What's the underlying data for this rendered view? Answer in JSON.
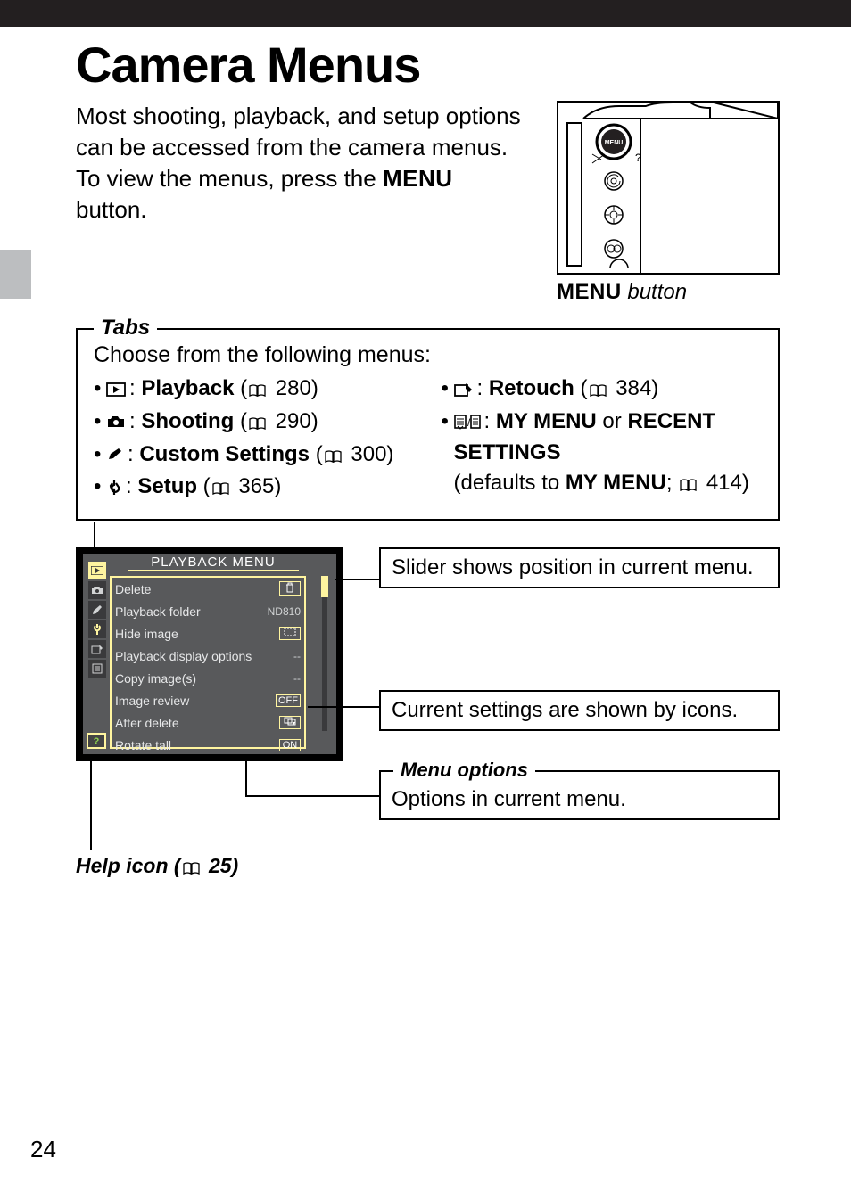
{
  "page_number": "24",
  "title": "Camera Menus",
  "intro": "Most shooting, playback, and setup options can be accessed from the camera menus.  To view the menus, press the ",
  "intro_menu_word": "MENU",
  "intro_tail": " button.",
  "camera_caption_menu": "MENU",
  "camera_caption_button": " button",
  "tabs": {
    "heading": "Tabs",
    "lead": "Choose from the following menus:",
    "left": [
      {
        "icon": "playback",
        "label": "Playback",
        "page": "280"
      },
      {
        "icon": "shooting",
        "label": "Shooting",
        "page": "290"
      },
      {
        "icon": "custom",
        "label": "Custom Settings",
        "page": "300"
      },
      {
        "icon": "setup",
        "label": "Setup",
        "page": "365"
      }
    ],
    "right": [
      {
        "icon": "retouch",
        "label": "Retouch",
        "page": "384"
      },
      {
        "icon": "mymenu",
        "label": "MY MENU",
        "or": " or ",
        "label2": "RECENT SETTINGS"
      }
    ],
    "defaults_pre": "(defaults to ",
    "defaults_bold": "MY MENU",
    "defaults_sep": "; ",
    "defaults_page": "414",
    "defaults_post": ")"
  },
  "screen": {
    "title": "PLAYBACK MENU",
    "options": [
      {
        "label": "Delete",
        "val_icon": "trash"
      },
      {
        "label": "Playback folder",
        "val_text": "ND810"
      },
      {
        "label": "Hide image",
        "val_icon": "hide"
      },
      {
        "label": "Playback display options",
        "val_text": "--"
      },
      {
        "label": "Copy image(s)",
        "val_text": "--"
      },
      {
        "label": "Image review",
        "val_text": "OFF"
      },
      {
        "label": "After delete",
        "val_icon": "after"
      },
      {
        "label": "Rotate tall",
        "val_text": "ON"
      }
    ]
  },
  "callouts": {
    "slider": "Slider shows position in current menu.",
    "icons": "Current settings are shown by icons.",
    "menu_options_title": "Menu options",
    "menu_options_text": "Options in current menu.",
    "help_pre": "Help icon (",
    "help_page": "25",
    "help_post": ")"
  }
}
